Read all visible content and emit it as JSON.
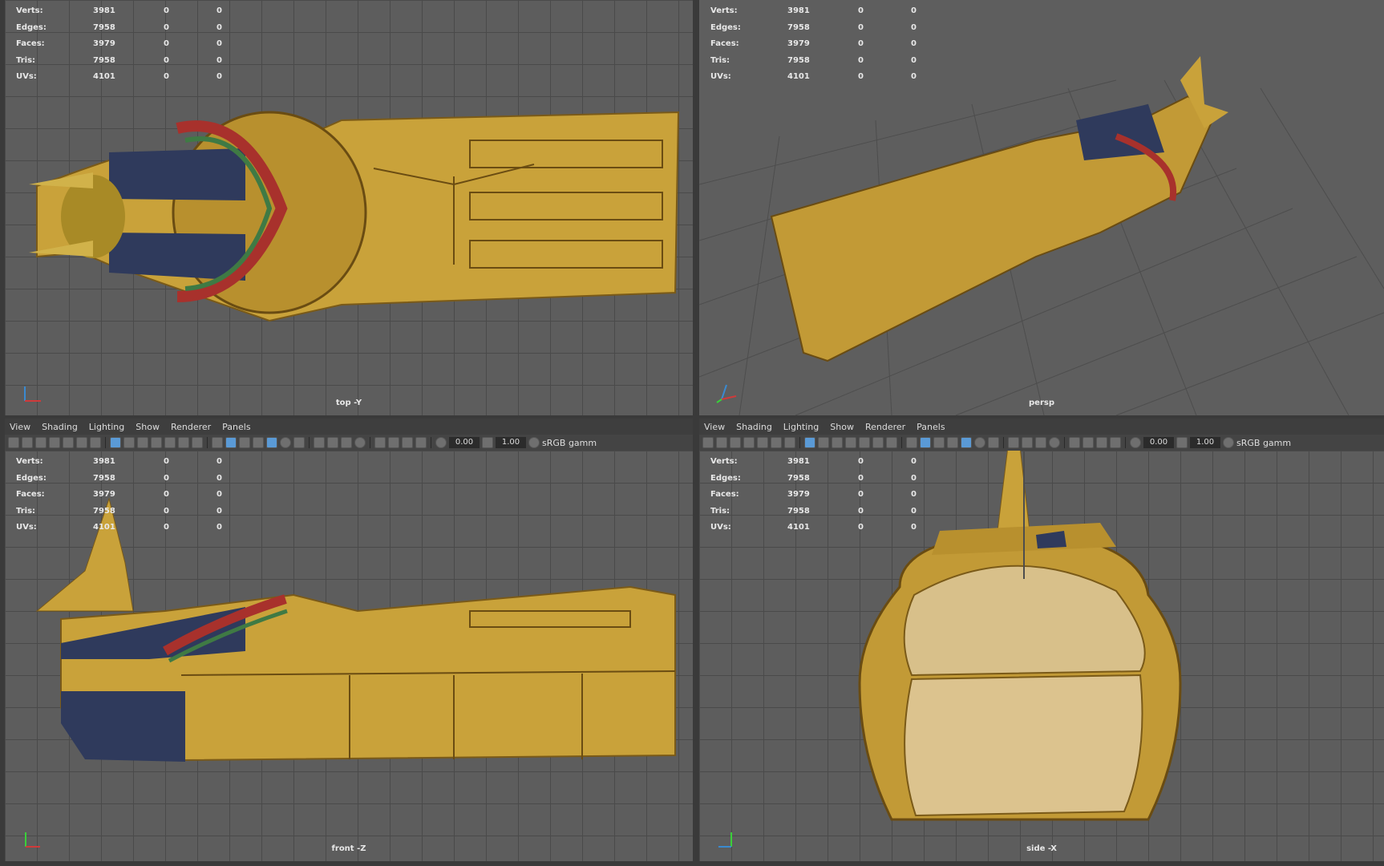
{
  "stats": [
    {
      "label": "Verts:",
      "v1": "3981",
      "v2": "0",
      "v3": "0"
    },
    {
      "label": "Edges:",
      "v1": "7958",
      "v2": "0",
      "v3": "0"
    },
    {
      "label": "Faces:",
      "v1": "3979",
      "v2": "0",
      "v3": "0"
    },
    {
      "label": "Tris:",
      "v1": "7958",
      "v2": "0",
      "v3": "0"
    },
    {
      "label": "UVs:",
      "v1": "4101",
      "v2": "0",
      "v3": "0"
    }
  ],
  "viewports": {
    "top": {
      "camera": "top -Y"
    },
    "persp": {
      "camera": "persp"
    },
    "front": {
      "camera": "front -Z"
    },
    "side": {
      "camera": "side -X"
    }
  },
  "panel_menu": [
    "View",
    "Shading",
    "Lighting",
    "Show",
    "Renderer",
    "Panels"
  ],
  "toolbar": {
    "field_a": "0.00",
    "field_b": "1.00",
    "color_space": "sRGB gamm"
  },
  "colors": {
    "gold": "#c9a23a",
    "gold_dark": "#8a6a1e",
    "blue": "#2f3a5c",
    "red": "#a8312c",
    "green": "#3f7a44"
  }
}
